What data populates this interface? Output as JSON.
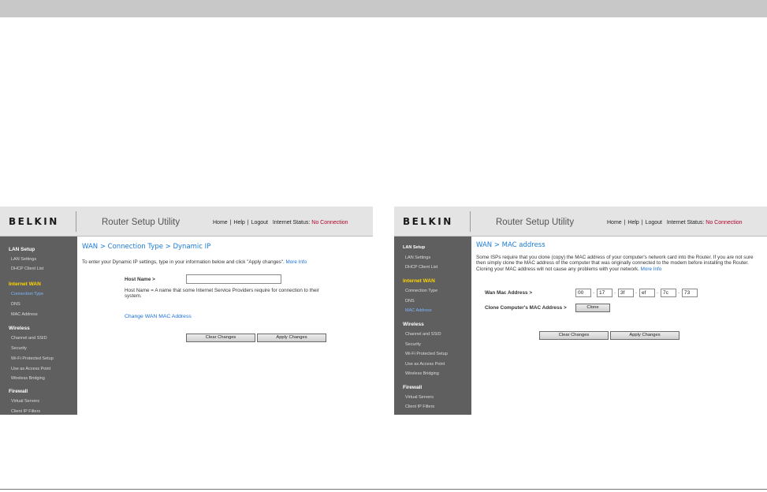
{
  "left": {
    "logo": "BELKIN",
    "app_title": "Router Setup Utility",
    "nav": {
      "home": "Home",
      "help": "Help",
      "logout": "Logout",
      "status_label": "Internet Status:",
      "status_value": "No Connection",
      "sep": "|"
    },
    "sidebar": {
      "lan_setup": "LAN Setup",
      "lan_settings": "LAN Settings",
      "dhcp_client_list": "DHCP Client List",
      "internet_wan": "Internet WAN",
      "connection_type": "Connection Type",
      "dns": "DNS",
      "mac_address": "MAC Address",
      "wireless": "Wireless",
      "channel_ssid": "Channel and SSID",
      "security": "Security",
      "wifi_protected": "Wi-Fi Protected Setup",
      "access_point": "Use as Access Point",
      "wireless_bridging": "Wireless Bridging",
      "firewall": "Firewall",
      "virtual_servers": "Virtual Servers",
      "client_ip_filters": "Client IP Filters"
    },
    "breadcrumb": "WAN > Connection Type > Dynamic IP",
    "intro": "To enter your Dynamic IP settings, type in your information below and click \"Apply changes\".",
    "more_info": "More Info",
    "host_name_label": "Host Name >",
    "host_name_value": "",
    "host_name_help": "Host Name = A name that some Internet Service Providers require for connection to their system.",
    "change_mac_link": "Change WAN MAC Address",
    "clear_button": "Clear Changes",
    "apply_button": "Apply Changes"
  },
  "right": {
    "logo": "BELKIN",
    "app_title": "Router Setup Utility",
    "nav": {
      "home": "Home",
      "help": "Help",
      "logout": "Logout",
      "status_label": "Internet Status:",
      "status_value": "No Connection",
      "sep": "|"
    },
    "sidebar": {
      "lan_setup": "LAN Setup",
      "lan_settings": "LAN Settings",
      "dhcp_client_list": "DHCP Client List",
      "internet_wan": "Internet WAN",
      "connection_type": "Connection Type",
      "dns": "DNS",
      "mac_address": "MAC Address",
      "wireless": "Wireless",
      "channel_ssid": "Channel and SSID",
      "security": "Security",
      "wifi_protected": "Wi-Fi Protected Setup",
      "access_point": "Use as Access Point",
      "wireless_bridging": "Wireless Bridging",
      "firewall": "Firewall",
      "virtual_servers": "Virtual Servers",
      "client_ip_filters": "Client IP Filters"
    },
    "breadcrumb": "WAN > MAC address",
    "intro": "Some ISPs require that you clone (copy) the MAC address of your computer's network card into the Router. If you are not sure then simply clone the MAC address of the computer that was originally connected to the modem before installing the Router. Cloning your MAC address will not cause any problems with your network.",
    "more_info": "More Info",
    "wan_mac_label": "Wan Mac Address >",
    "mac_octets": [
      "00",
      "17",
      "3f",
      "ef",
      "7c",
      "73"
    ],
    "mac_sep": ".",
    "clone_label": "Clone Computer's MAC Address >",
    "clone_button": "Clone",
    "clear_button": "Clear Changes",
    "apply_button": "Apply Changes"
  }
}
